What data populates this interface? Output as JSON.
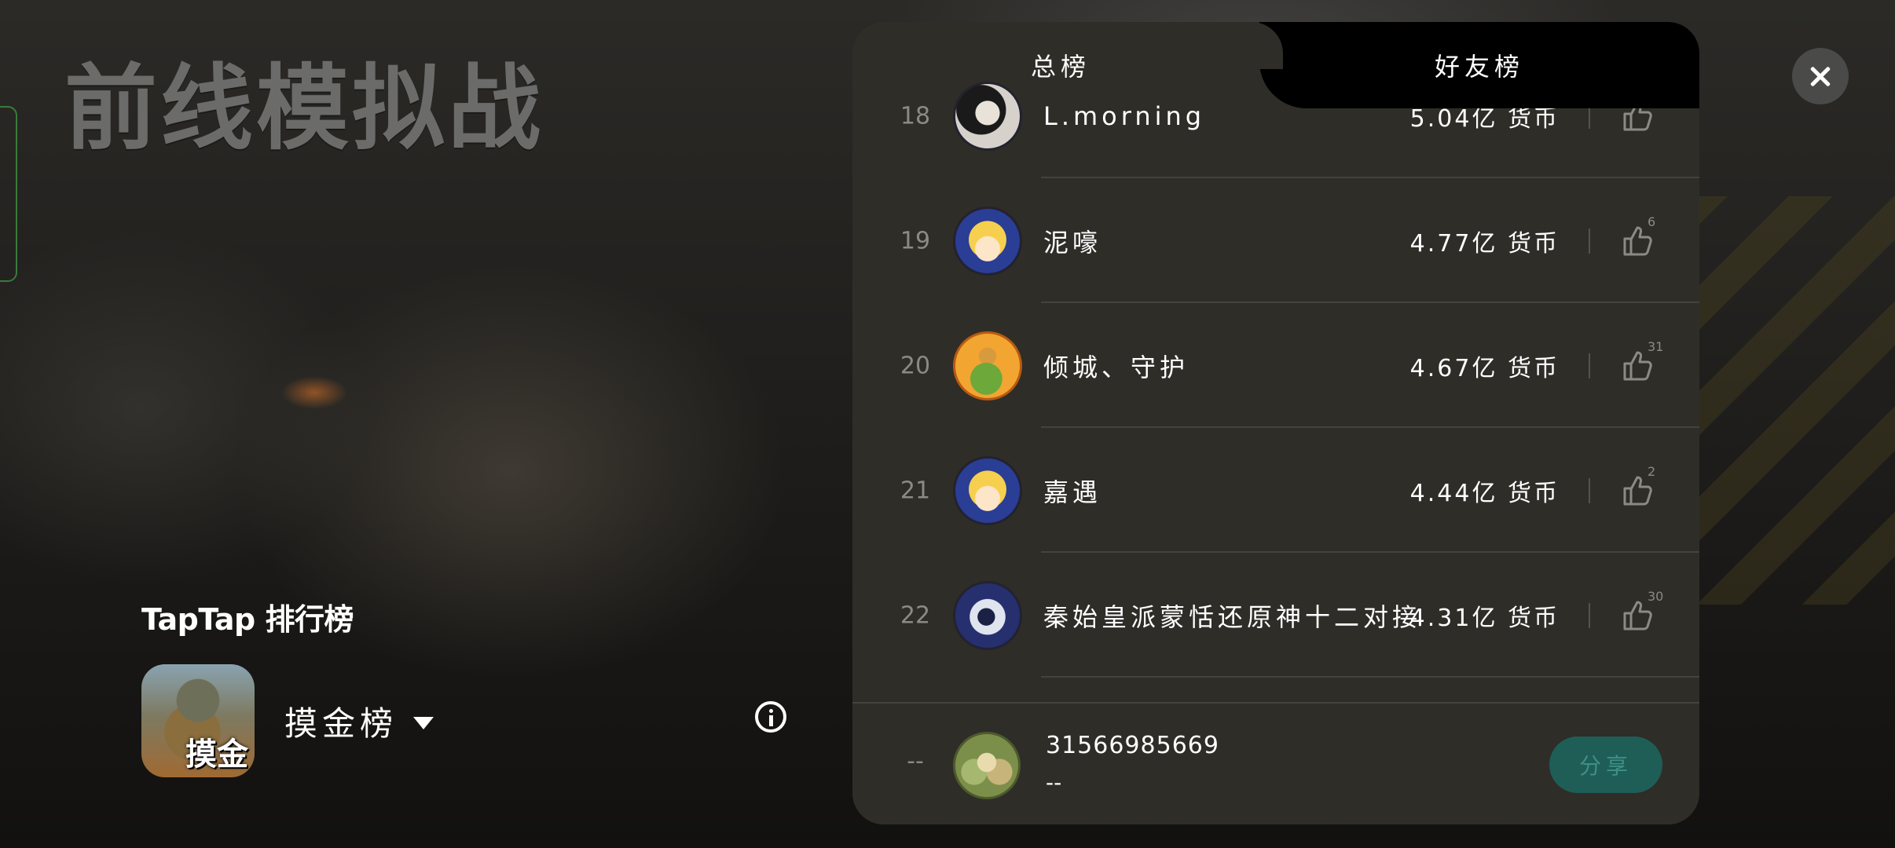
{
  "game_title": "前线模拟战",
  "leaderboard_brand": "TapTap 排行榜",
  "app_icon_label": "摸金",
  "board_selector": "摸金榜",
  "tabs": {
    "total": "总榜",
    "friends": "好友榜",
    "active": "total"
  },
  "ranking": [
    {
      "rank": "18",
      "name": "L.morning",
      "score": "5.04亿 货币",
      "likes": "",
      "avatar": "dark-hair-avatar"
    },
    {
      "rank": "19",
      "name": "泥嚎",
      "score": "4.77亿 货币",
      "likes": "6",
      "avatar": "blonde-anime-avatar"
    },
    {
      "rank": "20",
      "name": "倾城、守护",
      "score": "4.67亿 货币",
      "likes": "31",
      "avatar": "dinosaur-avatar"
    },
    {
      "rank": "21",
      "name": "嘉遇",
      "score": "4.44亿 货币",
      "likes": "2",
      "avatar": "blonde-anime-avatar"
    },
    {
      "rank": "22",
      "name": "秦始皇派蒙恬还原神十二对接",
      "score": "4.31亿 货币",
      "likes": "30",
      "avatar": "robot-avatar"
    }
  ],
  "self": {
    "rank": "--",
    "name": "31566985669",
    "score": "--"
  },
  "share_label": "分享",
  "colors": {
    "panel_bg": "#2f2d28",
    "share_bg": "#1e5e57",
    "share_text": "#3f8f86"
  }
}
